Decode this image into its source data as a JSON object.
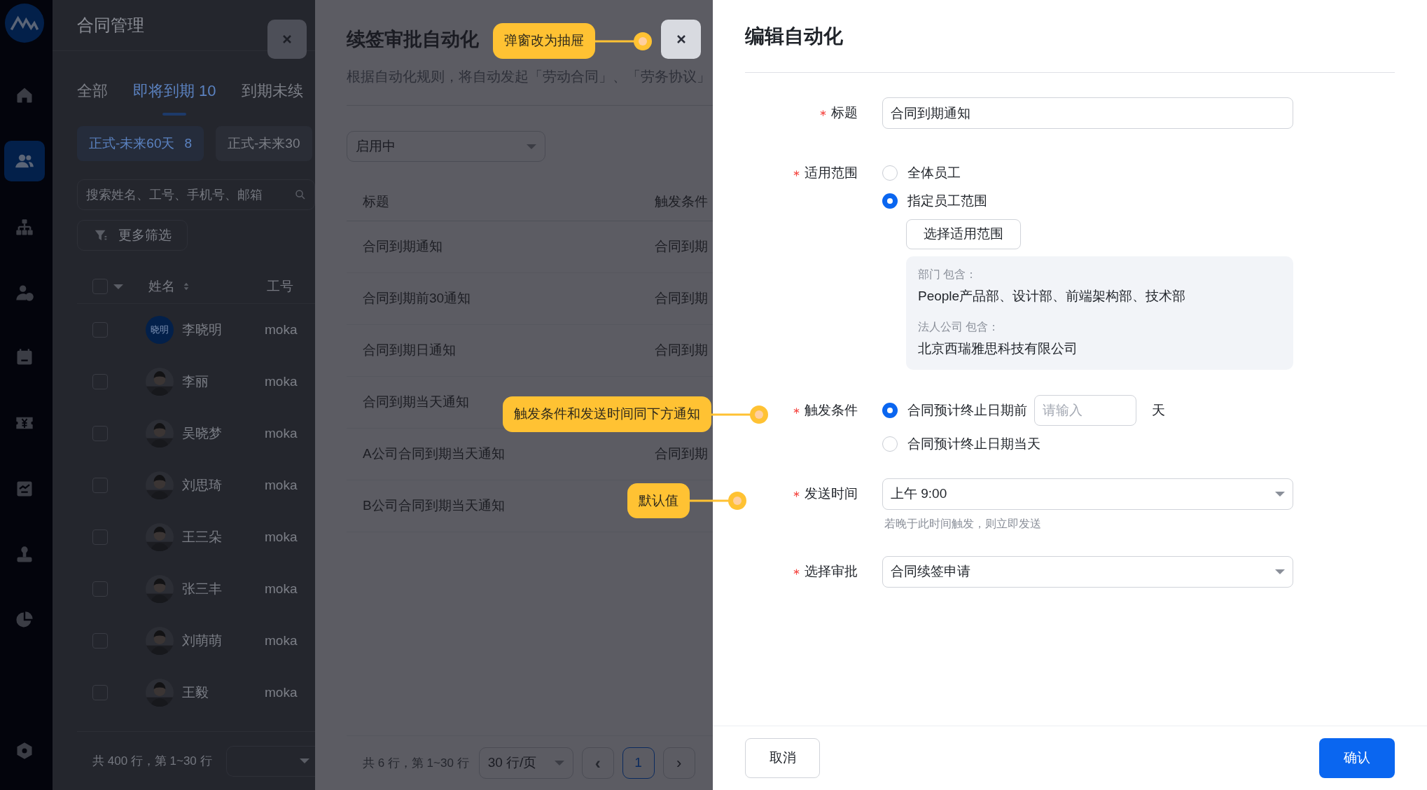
{
  "sidebar": {
    "items": [
      {
        "kind": "logo",
        "selected": false
      },
      {
        "kind": "home",
        "selected": false
      },
      {
        "kind": "people",
        "selected": true
      },
      {
        "kind": "org",
        "selected": false
      },
      {
        "kind": "user-add",
        "selected": false
      },
      {
        "kind": "calendar",
        "selected": false
      },
      {
        "kind": "yen",
        "selected": false
      },
      {
        "kind": "trend",
        "selected": false
      },
      {
        "kind": "stamp",
        "selected": false
      },
      {
        "kind": "pie",
        "selected": false
      },
      {
        "kind": "settings",
        "selected": false
      }
    ]
  },
  "contract_page": {
    "title": "合同管理",
    "tabs": [
      {
        "label": "全部",
        "selected": false
      },
      {
        "label": "即将到期 10",
        "selected": true
      },
      {
        "label": "到期未续",
        "selected": false
      }
    ],
    "chips": [
      {
        "label": "正式-未来60天",
        "count": "8",
        "selected": true
      },
      {
        "label": "正式-未来30",
        "selected": false
      }
    ],
    "search": {
      "placeholder": "搜索姓名、工号、手机号、邮箱"
    },
    "filter_button": "更多筛选",
    "table": {
      "columns": [
        "姓名",
        "工号"
      ],
      "select_all_checked": false,
      "rows": [
        {
          "kind": "text-avatar",
          "avatar_text": "晓明",
          "name": "李晓明",
          "column_2": "moka",
          "checked": false
        },
        {
          "kind": "picture",
          "name": "李丽",
          "column_2": "moka",
          "checked": false
        },
        {
          "kind": "picture",
          "name": "吴晓梦",
          "column_2": "moka",
          "checked": false
        },
        {
          "kind": "picture",
          "name": "刘思琦",
          "column_2": "moka",
          "checked": false
        },
        {
          "kind": "picture",
          "name": "王三朵",
          "column_2": "moka",
          "checked": false
        },
        {
          "kind": "picture",
          "name": "张三丰",
          "column_2": "moka",
          "checked": false
        },
        {
          "kind": "picture",
          "name": "刘萌萌",
          "column_2": "moka",
          "checked": false
        },
        {
          "kind": "picture",
          "name": "王毅",
          "column_2": "moka",
          "checked": false
        }
      ]
    },
    "footer": "共 400 行，第 1~30 行"
  },
  "automation_list": {
    "title": "续签审批自动化",
    "description": "根据自动化规则，将自动发起「劳动合同」、「劳务协议」",
    "status_select": "启用中",
    "columns": [
      "标题",
      "触发条件"
    ],
    "rows": [
      {
        "title": "合同到期通知",
        "trigger": "合同到期"
      },
      {
        "title": "合同到期前30通知",
        "trigger": "合同到期"
      },
      {
        "title": "合同到期日通知",
        "trigger": "合同到期"
      },
      {
        "title": "合同到期当天通知"
      },
      {
        "title": "A公司合同到期当天通知",
        "trigger": "合同到期"
      },
      {
        "title": "B公司合同到期当天通知"
      }
    ],
    "footer": {
      "summary": "共 6 行，第 1~30 行",
      "page_size": "30 行/页",
      "prev": "‹",
      "pages": [
        {
          "label": "1",
          "selected": true
        }
      ],
      "next": "›"
    }
  },
  "edit_drawer": {
    "title": "编辑自动化",
    "fields": [
      {
        "kind": "text",
        "label": "标题",
        "required": true,
        "value": "合同到期通知"
      },
      {
        "kind": "scope",
        "label": "适用范围",
        "required": true,
        "options": [
          {
            "label": "全体员工",
            "selected": false
          },
          {
            "label": "指定员工范围",
            "selected": true
          }
        ],
        "button": "选择适用范围",
        "summary": [
          {
            "heading": "部门 包含：",
            "value": "People产品部、设计部、前端架构部、技术部"
          },
          {
            "heading": "法人公司 包含：",
            "value": "北京西瑞雅思科技有限公司"
          }
        ]
      },
      {
        "kind": "trigger",
        "label": "触发条件",
        "required": true,
        "options": [
          {
            "label": "合同预计终止日期前",
            "selected": true,
            "input_placeholder": "请输入",
            "unit": "天"
          },
          {
            "label": "合同预计终止日期当天",
            "selected": false
          }
        ]
      },
      {
        "kind": "select",
        "label": "发送时间",
        "required": true,
        "value": "上午 9:00",
        "hint": "若晚于此时间触发，则立即发送"
      },
      {
        "kind": "select",
        "label": "选择审批",
        "required": true,
        "value": "合同续签申请"
      }
    ],
    "cancel": "取消",
    "confirm": "确认"
  },
  "annotations": [
    {
      "text": "弹窗改为抽屉"
    },
    {
      "text": "触发条件和发送时间同下方通知"
    },
    {
      "text": "默认值"
    }
  ]
}
